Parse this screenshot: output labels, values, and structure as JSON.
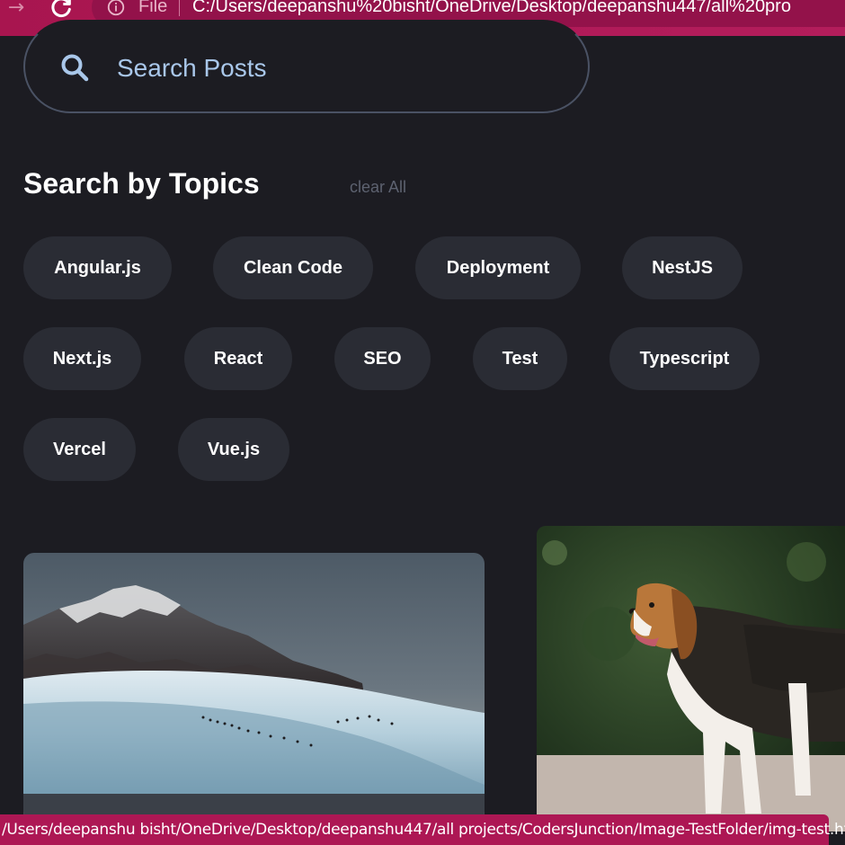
{
  "browser": {
    "file_label": "File",
    "url": "C:/Users/deepanshu%20bisht/OneDrive/Desktop/deepanshu447/all%20pro"
  },
  "search": {
    "placeholder": "Search Posts"
  },
  "topics": {
    "title": "Search by Topics",
    "clear_label": "clear All",
    "items": [
      "Angular.js",
      "Clean Code",
      "Deployment",
      "NestJS",
      "Next.js",
      "React",
      "SEO",
      "Test",
      "Typescript",
      "Vercel",
      "Vue.js"
    ]
  },
  "status_bar": {
    "text": "/Users/deepanshu bisht/OneDrive/Desktop/deepanshu447/all projects/CodersJunction/Image-TestFolder/img-test.html"
  },
  "colors": {
    "background": "#1c1c22",
    "chip": "#2a2c34",
    "browser_accent": "#ad1754",
    "search_text": "#a9c7ea"
  }
}
